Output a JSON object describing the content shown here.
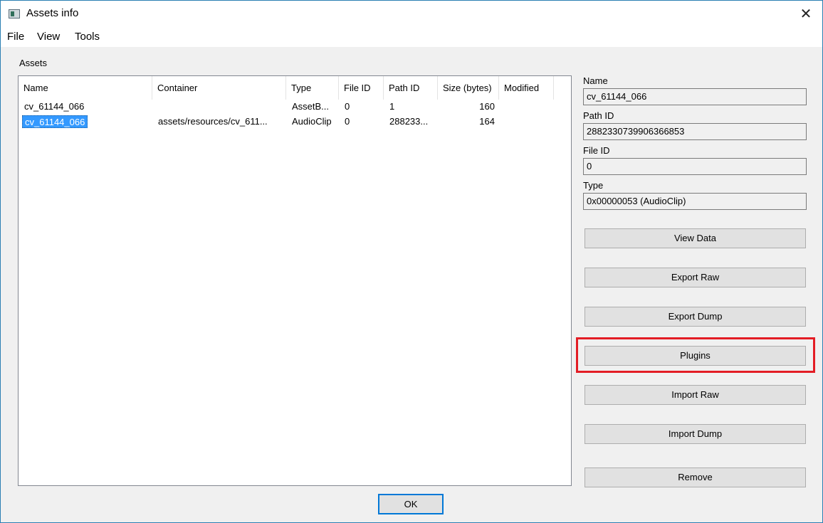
{
  "window": {
    "title": "Assets info",
    "close_glyph": "✕"
  },
  "menu": [
    {
      "label": "File"
    },
    {
      "label": "View"
    },
    {
      "label": "Tools"
    }
  ],
  "assets_group": {
    "label": "Assets"
  },
  "table": {
    "columns": [
      "Name",
      "Container",
      "Type",
      "File ID",
      "Path ID",
      "Size (bytes)",
      "Modified"
    ],
    "rows": [
      {
        "name": "cv_61144_066",
        "container": "",
        "type": "AssetB...",
        "file_id": "0",
        "path_id": "1",
        "size": "160",
        "modified": "",
        "selected": false
      },
      {
        "name": "cv_61144_066",
        "container": "assets/resources/cv_611...",
        "type": "AudioClip",
        "file_id": "0",
        "path_id": "288233...",
        "size": "164",
        "modified": "",
        "selected": true
      }
    ]
  },
  "details": {
    "name_label": "Name",
    "name_value": "cv_61144_066",
    "path_id_label": "Path ID",
    "path_id_value": "2882330739906366853",
    "file_id_label": "File ID",
    "file_id_value": "0",
    "type_label": "Type",
    "type_value": "0x00000053 (AudioClip)"
  },
  "buttons": {
    "view_data": "View Data",
    "export_raw": "Export Raw",
    "export_dump": "Export Dump",
    "plugins": "Plugins",
    "import_raw": "Import Raw",
    "import_dump": "Import Dump",
    "remove": "Remove",
    "ok": "OK"
  },
  "colors": {
    "highlight": "#e31d25",
    "selection": "#3399ff",
    "focus": "#0078d7"
  }
}
